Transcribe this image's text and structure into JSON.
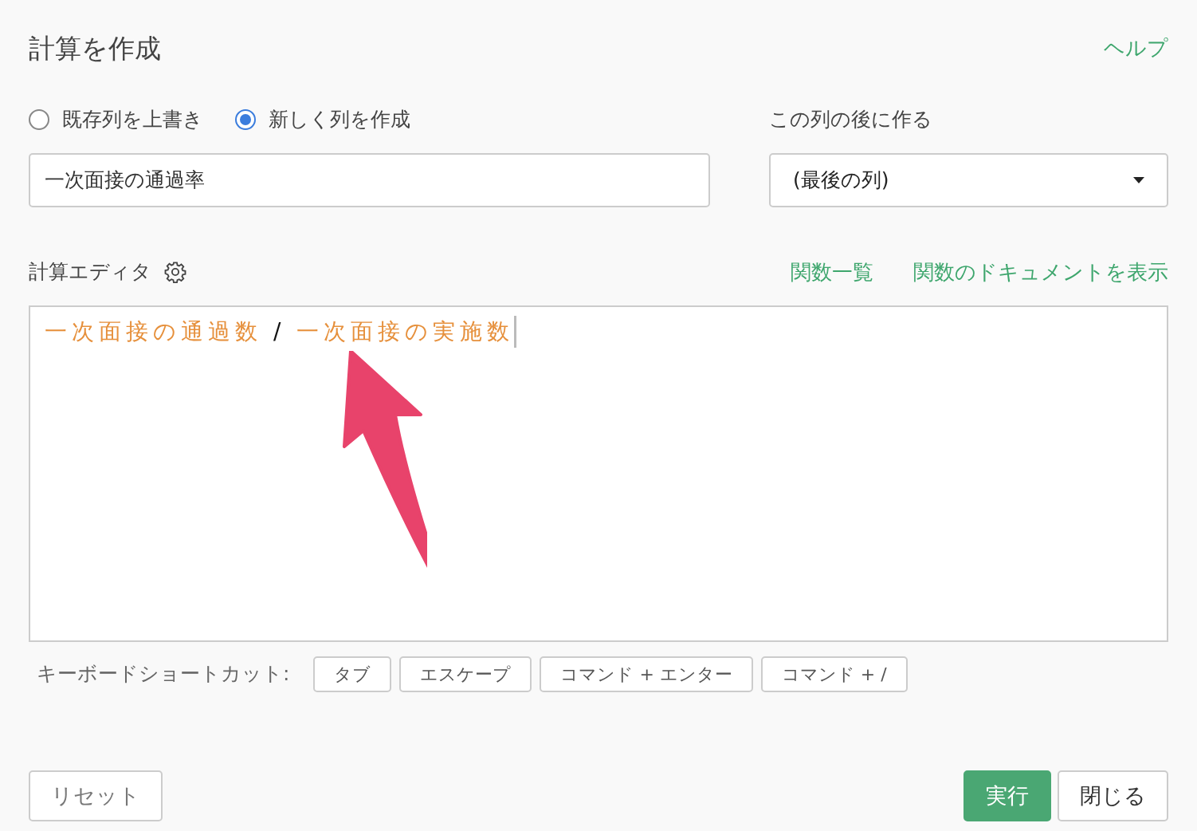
{
  "title": "計算を作成",
  "help_link": "ヘルプ",
  "mode_options": [
    {
      "label": "既存列を上書き",
      "selected": false
    },
    {
      "label": "新しく列を作成",
      "selected": true
    }
  ],
  "column_name": {
    "value": "一次面接の通過率"
  },
  "position": {
    "label": "この列の後に作る",
    "value": "(最後の列)"
  },
  "editor": {
    "label": "計算エディタ",
    "links": [
      "関数一覧",
      "関数のドキュメントを表示"
    ],
    "tokens": [
      {
        "kind": "column",
        "text": "一次面接の通過数"
      },
      {
        "kind": "operator",
        "text": "/"
      },
      {
        "kind": "column",
        "text": "一次面接の実施数"
      }
    ]
  },
  "shortcuts": {
    "label": "キーボードショートカット:",
    "keys": [
      "タブ",
      "エスケープ",
      "コマンド + エンター",
      "コマンド + /"
    ]
  },
  "buttons": [
    {
      "label": "リセット",
      "kind": "secondary"
    },
    {
      "label": "実行",
      "kind": "primary"
    },
    {
      "label": "閉じる",
      "kind": "default"
    }
  ]
}
